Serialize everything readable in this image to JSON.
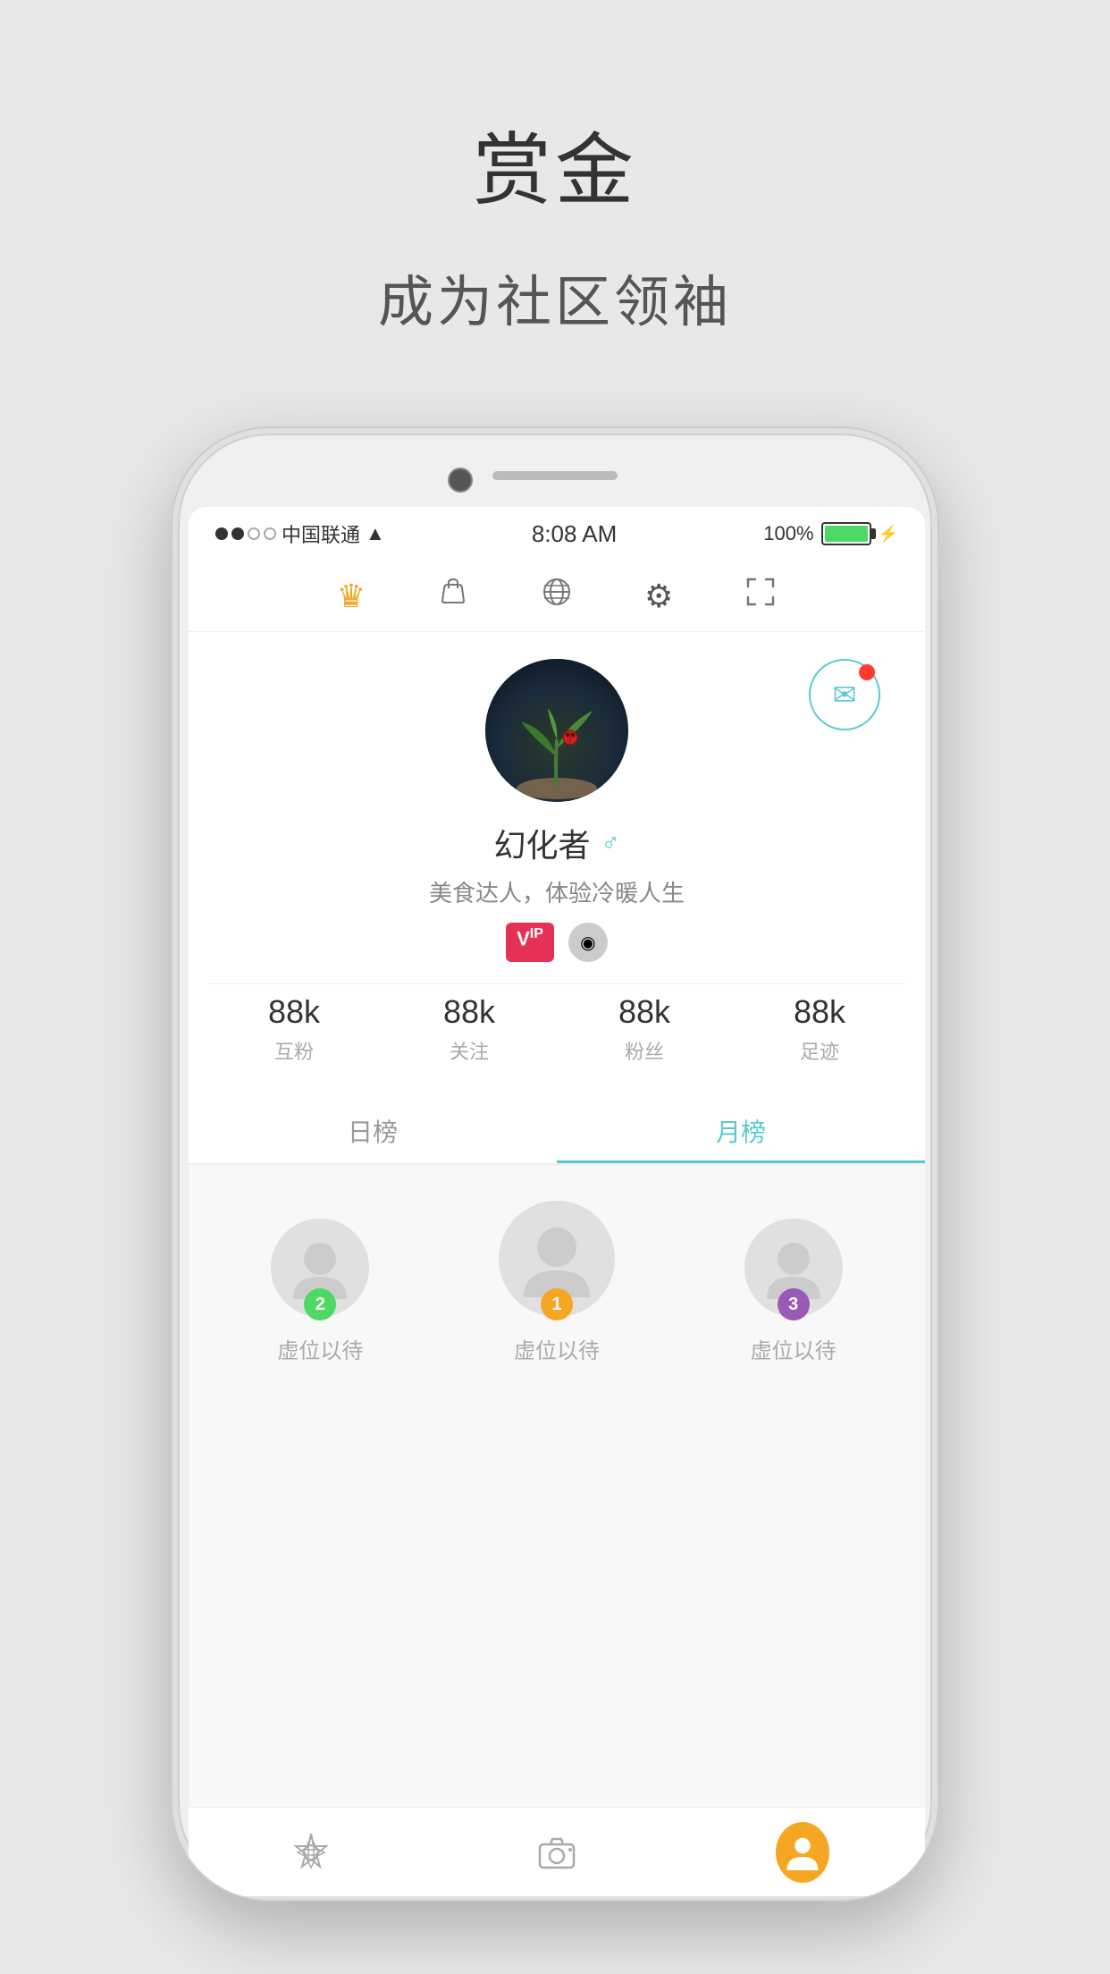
{
  "page": {
    "bg_title": "赏金",
    "bg_subtitle": "成为社区领袖"
  },
  "status_bar": {
    "carrier": "中国联通",
    "time": "8:08 AM",
    "battery": "100%"
  },
  "top_nav": {
    "icons": [
      {
        "name": "crown",
        "label": "皇冠",
        "active": true
      },
      {
        "name": "bag",
        "label": "袋子",
        "active": false
      },
      {
        "name": "globe",
        "label": "地球",
        "active": false
      },
      {
        "name": "gear",
        "label": "设置",
        "active": false
      },
      {
        "name": "scan",
        "label": "扫描",
        "active": false
      }
    ]
  },
  "profile": {
    "username": "幻化者",
    "bio": "美食达人，体验冷暖人生",
    "vip_badge": "VIP",
    "stats": [
      {
        "num": "88k",
        "label": "互粉"
      },
      {
        "num": "88k",
        "label": "关注"
      },
      {
        "num": "88k",
        "label": "粉丝"
      },
      {
        "num": "88k",
        "label": "足迹"
      }
    ]
  },
  "tabs": [
    {
      "label": "日榜",
      "active": false
    },
    {
      "label": "月榜",
      "active": true
    }
  ],
  "leaderboard": {
    "positions": [
      {
        "rank": 2,
        "name": "虚位以待"
      },
      {
        "rank": 1,
        "name": "虚位以待"
      },
      {
        "rank": 3,
        "name": "虚位以待"
      }
    ]
  },
  "bottom_nav": [
    {
      "label": "star-icon",
      "name": "home-nav"
    },
    {
      "label": "camera-icon",
      "name": "camera-nav"
    },
    {
      "label": "person-icon",
      "name": "profile-nav",
      "active": true
    }
  ]
}
